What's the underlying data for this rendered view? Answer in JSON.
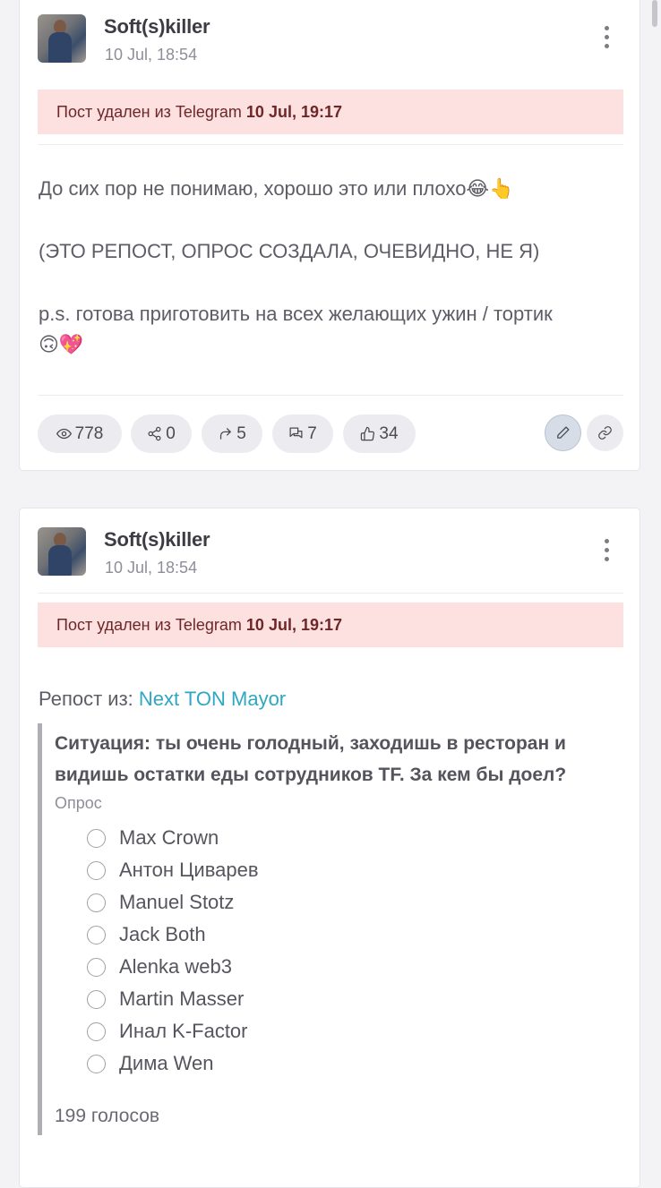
{
  "posts": [
    {
      "author": "Soft(s)killer",
      "date": "10 Jul, 18:54",
      "deleted_prefix": "Пост удален из Telegram",
      "deleted_date": "10 Jul, 19:17",
      "lines": [
        "До сих пор не понимаю, хорошо это или плохо😂👆",
        "(ЭТО РЕПОСТ, ОПРОС СОЗДАЛА, ОЧЕВИДНО, НЕ Я)",
        "p.s. готова приготовить на всех желающих ужин / тортик",
        "🙃💖"
      ],
      "stats": {
        "views": "778",
        "shares": "0",
        "forwards": "5",
        "comments": "7",
        "likes": "34"
      }
    },
    {
      "author": "Soft(s)killer",
      "date": "10 Jul, 18:54",
      "deleted_prefix": "Пост удален из Telegram",
      "deleted_date": "10 Jul, 19:17",
      "repost_prefix": "Репост из:",
      "repost_source": "Next TON Mayor",
      "poll": {
        "question": "Ситуация: ты очень голодный, заходишь в ресторан и видишь остатки еды сотрудников TF. За кем бы доел?",
        "label": "Опрос",
        "options": [
          "Max Crown",
          "Антон Циварев",
          "Manuel Stotz",
          "Jack Both",
          "Alenka web3",
          "Martin Masser",
          "Инал K-Factor",
          "Дима Wen"
        ],
        "votes": "199 голосов"
      }
    }
  ],
  "colors": {
    "deleted_bg": "#fde0e0",
    "deleted_text": "#6d2727",
    "link": "#2fa7c2",
    "pill_bg": "#ececf0"
  }
}
